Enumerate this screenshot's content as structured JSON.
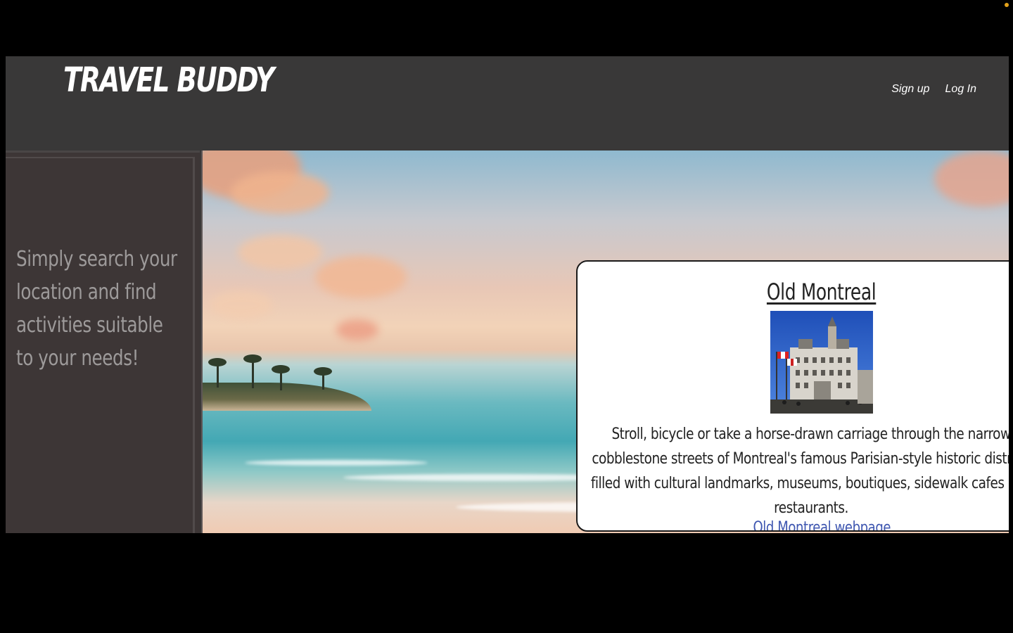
{
  "header": {
    "brand": "TRAVEL BUDDY",
    "nav": {
      "signup": "Sign up",
      "login": "Log In"
    }
  },
  "sidebar": {
    "tagline": "Simply search your location and find activities suitable to your needs!"
  },
  "card": {
    "title": "Old Montreal",
    "image_alt": "Old Montreal city hall",
    "description": "Stroll, bicycle or take a horse-drawn carriage through the narrow cobblestone streets of Montreal's famous Parisian-style historic district, filled with cultural landmarks, museums, boutiques, sidewalk cafes and restaurants.",
    "link_text": "Old Montreal webpage"
  },
  "colors": {
    "header_bg": "#393838",
    "sidebar_bg": "#3d3636",
    "tagline_text": "#9d9a9a",
    "link": "#3e56b0",
    "status_dot": "#e3a21a"
  }
}
